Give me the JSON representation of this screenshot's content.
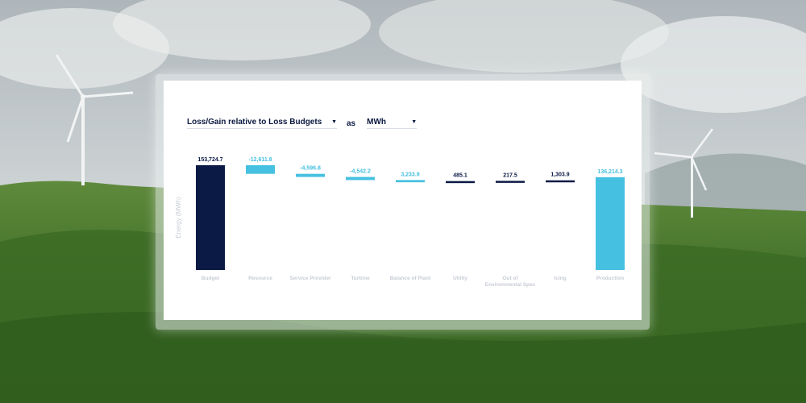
{
  "controls": {
    "metric": "Loss/Gain relative to Loss Budgets",
    "connector": "as",
    "unit": "MWh",
    "caret_icon": "triangle-down-icon"
  },
  "colors": {
    "budget": "#0b1a45",
    "loss": "#45c0e0",
    "gain": "#0b1a45",
    "production": "#45c0e0",
    "axis_label": "#c8ccd6"
  },
  "chart_data": {
    "type": "bar",
    "subtype": "waterfall",
    "ylabel": "Energy (MWh)",
    "xlabel": "",
    "grid": false,
    "legend": "none",
    "categories": [
      "Budget",
      "Resource",
      "Service Provider",
      "Turbine",
      "Balance of Plant",
      "Utility",
      "Out of Environmental Spec",
      "Icing",
      "Production"
    ],
    "values": [
      153724.7,
      -12611.8,
      -4596.8,
      -4542.2,
      -3233.9,
      485.1,
      217.5,
      1303.9,
      136214.3
    ],
    "labels": [
      "153,724.7",
      "-12,611.8",
      "-4,596.8",
      "-4,542.2",
      "3,233.9",
      "485.1",
      "217.5",
      "1,303.9",
      "136,214.3"
    ],
    "kinds": [
      "total",
      "loss",
      "loss",
      "loss",
      "loss",
      "gain",
      "gain",
      "gain",
      "total"
    ]
  }
}
